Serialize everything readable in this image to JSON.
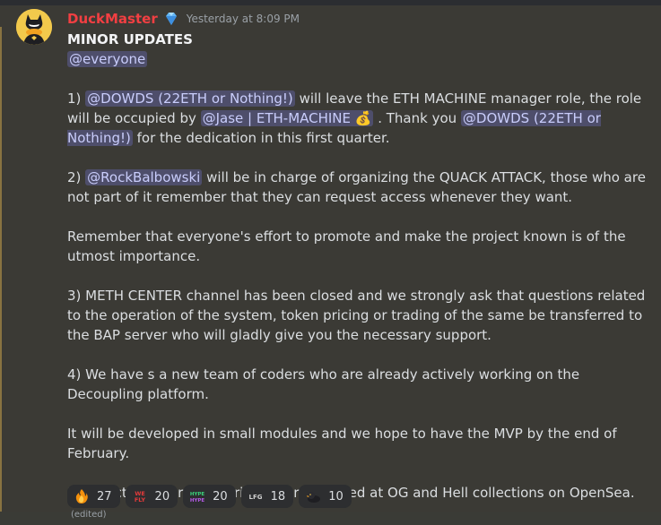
{
  "message": {
    "username": "DuckMaster",
    "timestamp": "Yesterday at 8:09 PM",
    "title": "MINOR UPDATES",
    "everyone": "@everyone",
    "p1": {
      "prefix": "1) ",
      "mention1": "@DOWDS (22ETH or Nothing!)",
      "mid1": "  will leave the  ETH MACHINE manager role, the role will be occupied by ",
      "mention2": "@Jase | ETH-MACHINE 💰",
      "mid2": " . Thank you ",
      "mention3": "@DOWDS (22ETH or Nothing!)",
      "end": "  for the dedication in this first quarter."
    },
    "p2": {
      "prefix": "2) ",
      "mention": "@RockBalbowski",
      "end": "  will be in charge of organizing the QUACK ATTACK, those who are not part of it remember that they can request access whenever they want."
    },
    "p3": "Remember that everyone's effort to promote and make the project known is of the utmost importance.",
    "p4": "3) METH CENTER channel has been closed and we strongly ask that questions related to the operation of the system, token pricing or trading of the same be transferred to the BAP server who will gladly give you the necessary support.",
    "p5": "4) We have s a new team of coders who are already actively working on the Decoupling platform.",
    "p6": "It will be developed in small modules and we hope to have the MVP by the end of February.",
    "p7": "5)Collection offers by attributes are enabled at OG and Hell collections on OpenSea.",
    "edited": "(edited)"
  },
  "reactions": [
    {
      "icon": "fire-emoji-icon",
      "count": "27"
    },
    {
      "icon": "we-fly-emoji-icon",
      "label": "WE FLY",
      "count": "20"
    },
    {
      "icon": "hype-emoji-icon",
      "label": "HYPE",
      "count": "20"
    },
    {
      "icon": "lfg-emoji-icon",
      "label": "LFG",
      "count": "18"
    },
    {
      "icon": "duck-emoji-icon",
      "count": "10"
    }
  ],
  "colors": {
    "username": "#f23f42",
    "mention_bg": "#4e4e6b",
    "mention_text": "#c9cdfb",
    "background": "#3b3a35"
  }
}
